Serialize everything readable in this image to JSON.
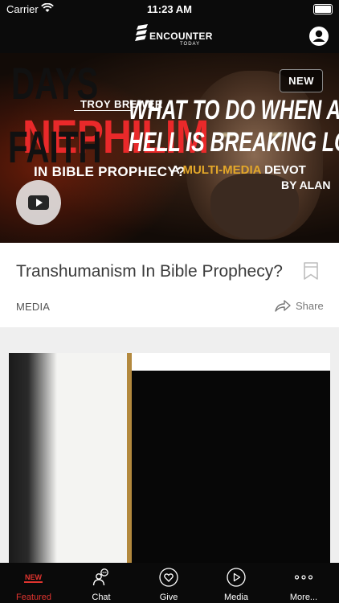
{
  "status_bar": {
    "carrier": "Carrier",
    "time": "11:23 AM"
  },
  "header": {
    "logo_word": "ENCOUNTER",
    "logo_sub": "TODAY"
  },
  "featured": {
    "badge": "NEW",
    "author": "TROY BREWER",
    "headline": "NEPHILIM",
    "subheadline": "IN BIBLE PROPHECY?",
    "title": "Transhumanism In Bible Prophecy?",
    "category": "MEDIA",
    "share_label": "Share"
  },
  "second_card": {
    "left_line1": "DAYS",
    "left_line2": "FAITH",
    "line1": "WHAT TO DO WHEN A",
    "line2": "HELL IS BREAKING LO",
    "line3_pre": "A ",
    "line3_hl": "MULTI-MEDIA",
    "line3_post": " DEVOT",
    "line4": "BY ALAN"
  },
  "tabs": [
    {
      "label": "Featured",
      "icon": "new-icon",
      "active": true,
      "badge": "NEW"
    },
    {
      "label": "Chat",
      "icon": "chat-icon"
    },
    {
      "label": "Give",
      "icon": "heart-icon"
    },
    {
      "label": "Media",
      "icon": "play-icon"
    },
    {
      "label": "More...",
      "icon": "more-icon"
    }
  ],
  "colors": {
    "accent": "#e0342f",
    "hero_title": "#e9292a",
    "gold": "#b3893e"
  }
}
